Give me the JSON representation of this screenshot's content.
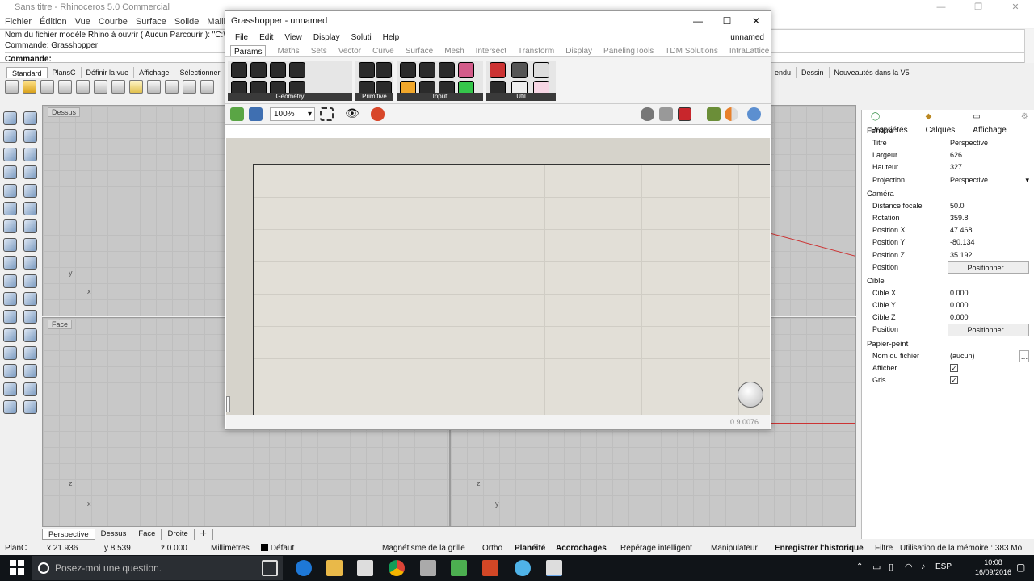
{
  "rhino": {
    "title": "Sans titre - Rhinoceros 5.0 Commercial",
    "menu": [
      "Fichier",
      "Édition",
      "Vue",
      "Courbe",
      "Surface",
      "Solide",
      "Maillage"
    ],
    "command_history": [
      "Nom du fichier modèle Rhino à ouvrir ( Aucun  Parcourir ): \"C:\\",
      "Commande: Grasshopper"
    ],
    "command_prompt": "Commande:",
    "toolbar_tabs": [
      "Standard",
      "PlansC",
      "Définir la vue",
      "Affichage",
      "Sélectionner"
    ],
    "toolbar_tabs_right": [
      "endu",
      "Dessin",
      "Nouveautés dans la V5"
    ],
    "viewports": {
      "top_label": "Dessus",
      "front_label": "Face"
    },
    "viewport_tabs": [
      "Perspective",
      "Dessus",
      "Face",
      "Droite"
    ],
    "axis": {
      "x": "x",
      "y": "y",
      "z": "z"
    }
  },
  "grasshopper": {
    "title": "Grasshopper - unnamed",
    "menu": [
      "File",
      "Edit",
      "View",
      "Display",
      "Soluti",
      "Help"
    ],
    "document": "unnamed",
    "tabs": [
      "Params",
      "Maths",
      "Sets",
      "Vector",
      "Curve",
      "Surface",
      "Mesh",
      "Intersect",
      "Transform",
      "Display",
      "PanelingTools",
      "TDM Solutions",
      "IntraLattice"
    ],
    "groups": [
      "Geometry",
      "Primitive",
      "Input",
      "Util"
    ],
    "zoom": "100%",
    "version": "0.9.0076"
  },
  "properties": {
    "tabs": [
      "Propriétés",
      "Calques",
      "Affichage"
    ],
    "sections": {
      "fenetre": "Fenêtre",
      "camera": "Caméra",
      "cible": "Cible",
      "papier": "Papier-peint"
    },
    "fenetre_rows": [
      {
        "k": "Titre",
        "v": "Perspective"
      },
      {
        "k": "Largeur",
        "v": "626"
      },
      {
        "k": "Hauteur",
        "v": "327"
      },
      {
        "k": "Projection",
        "v": "Perspective"
      }
    ],
    "camera_rows": [
      {
        "k": "Distance focale",
        "v": "50.0"
      },
      {
        "k": "Rotation",
        "v": "359.8"
      },
      {
        "k": "Position X",
        "v": "47.468"
      },
      {
        "k": "Position Y",
        "v": "-80.134"
      },
      {
        "k": "Position Z",
        "v": "35.192"
      }
    ],
    "position_label": "Position",
    "positionner": "Positionner...",
    "cible_rows": [
      {
        "k": "Cible X",
        "v": "0.000"
      },
      {
        "k": "Cible Y",
        "v": "0.000"
      },
      {
        "k": "Cible Z",
        "v": "0.000"
      }
    ],
    "papier_rows": [
      {
        "k": "Nom du fichier",
        "v": "(aucun)"
      },
      {
        "k": "Afficher",
        "v": "✓"
      },
      {
        "k": "Gris",
        "v": "✓"
      }
    ]
  },
  "statusbar": {
    "plan": "PlanC",
    "x": "x 21.936",
    "y": "y 8.539",
    "z": "z 0.000",
    "units": "Millimètres",
    "layer": "Défaut",
    "grille": "Magnétisme de la grille",
    "ortho": "Ortho",
    "planeite": "Planéité",
    "accrochages": "Accrochages",
    "reperage": "Repérage intelligent",
    "manipulateur": "Manipulateur",
    "historique": "Enregistrer l'historique",
    "filtre": "Filtre",
    "memoire": "Utilisation de la mémoire : 383 Mo"
  },
  "taskbar": {
    "search_placeholder": "Posez-moi une question.",
    "lang": "ESP",
    "time": "10:08",
    "date": "16/09/2016"
  }
}
